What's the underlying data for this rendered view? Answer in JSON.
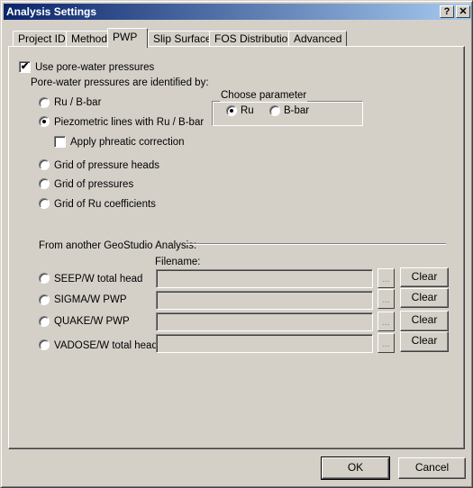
{
  "window": {
    "title": "Analysis Settings",
    "help_label": "?",
    "close_label": "✕"
  },
  "tabs": [
    {
      "label": "Project ID"
    },
    {
      "label": "Method"
    },
    {
      "label": "PWP",
      "active": true
    },
    {
      "label": "Slip Surface"
    },
    {
      "label": "FOS Distribution"
    },
    {
      "label": "Advanced"
    }
  ],
  "pwp": {
    "use_pwp": {
      "label": "Use pore-water pressures",
      "checked": true
    },
    "identified_by": "Pore-water pressures are identified by:",
    "options": [
      {
        "label": "Ru / B-bar",
        "selected": false
      },
      {
        "label": "Piezometric lines with Ru / B-bar",
        "selected": true
      },
      {
        "label": "Grid of pressure heads",
        "selected": false
      },
      {
        "label": "Grid of pressures",
        "selected": false
      },
      {
        "label": "Grid of Ru coefficients",
        "selected": false
      }
    ],
    "phreatic": {
      "label": "Apply phreatic correction",
      "checked": false
    },
    "param_group": {
      "title": "Choose parameter",
      "options": [
        {
          "label": "Ru",
          "selected": true
        },
        {
          "label": "B-bar",
          "selected": false
        }
      ]
    },
    "geostudio": {
      "title": "From another GeoStudio Analysis:",
      "filename_label": "Filename:",
      "rows": [
        {
          "label": "SEEP/W total head",
          "value": "",
          "browse": "...",
          "clear": "Clear"
        },
        {
          "label": "SIGMA/W PWP",
          "value": "",
          "browse": "...",
          "clear": "Clear"
        },
        {
          "label": "QUAKE/W PWP",
          "value": "",
          "browse": "...",
          "clear": "Clear"
        },
        {
          "label": "VADOSE/W total head",
          "value": "",
          "browse": "...",
          "clear": "Clear"
        }
      ]
    }
  },
  "footer": {
    "ok": "OK",
    "cancel": "Cancel"
  }
}
